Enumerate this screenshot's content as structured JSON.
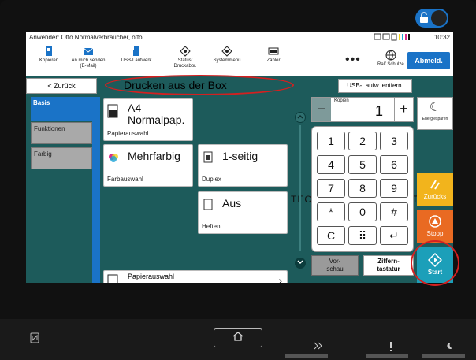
{
  "status": {
    "user": "Anwender: Otto Normalverbraucher, otto",
    "time": "10:32"
  },
  "toolbar": {
    "items": [
      {
        "label": "Kopieren"
      },
      {
        "label": "An mich senden (E-Mail)"
      },
      {
        "label": "USB-Laufwerk"
      },
      {
        "label": "Status/ Druckabbr."
      },
      {
        "label": "Systemmenü"
      },
      {
        "label": "Zähler"
      }
    ],
    "more": "•••",
    "user_name": "Ralf Schulze",
    "logout": "Abmeld."
  },
  "nav": {
    "back": "< Zurück",
    "title": "Drucken aus der Box",
    "usb_remove": "USB-Laufw. entfern."
  },
  "tabs": [
    {
      "label": "Basis",
      "active": true
    },
    {
      "label": "Funktionen",
      "active": false
    },
    {
      "label": "Farbig",
      "active": false
    }
  ],
  "cards": {
    "paper": {
      "value_top": "A4",
      "value_bottom": "Normalpap.",
      "caption": "Papierauswahl"
    },
    "color": {
      "value": "Mehrfarbig",
      "caption": "Farbauswahl"
    },
    "duplex": {
      "value": "1-seitig",
      "caption": "Duplex"
    },
    "staple": {
      "value": "Aus",
      "caption": "Heften"
    },
    "paper2": {
      "caption": "Papierauswahl",
      "chevron": "›"
    }
  },
  "background_text": "TECH",
  "background_text_2": "T",
  "copies": {
    "label": "Kopien",
    "value": "1",
    "minus": "−",
    "plus": "+"
  },
  "keypad": {
    "keys": [
      "1",
      "2",
      "3",
      "4",
      "5",
      "6",
      "7",
      "8",
      "9",
      "*",
      "0",
      "#",
      "C",
      "⠿",
      "↵"
    ]
  },
  "buttons": {
    "preview": "Vor-\nschau",
    "keypad": "Ziffern-\ntastatur",
    "energy": "Energiesparen",
    "return": "Zurücks",
    "stop": "Stopp",
    "start": "Start"
  },
  "colors": {
    "screen_bg": "#1d5b5b",
    "accent_blue": "#1a73c7",
    "return_yellow": "#f2b41c",
    "stop_orange": "#e96a22",
    "start_teal": "#1c9fb9",
    "highlight_red": "#d42020"
  },
  "hardware": {
    "home_icon": "house-icon",
    "nfc_icon": "nfc-icon",
    "led_icons": [
      "data-led-icon",
      "attention-led-icon",
      "energy-led-icon"
    ]
  }
}
